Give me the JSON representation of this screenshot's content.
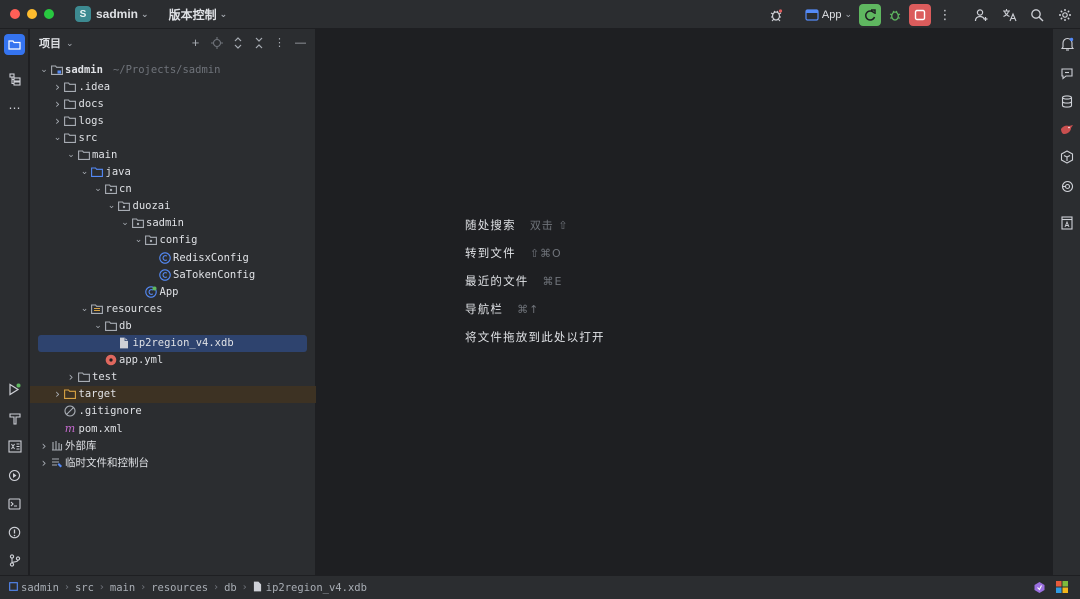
{
  "titlebar": {
    "project_badge": "S",
    "project_name": "sadmin",
    "vcs_label": "版本控制",
    "run_config": "App",
    "colors": {
      "run_button": "#5fb760",
      "stop_button": "#db5c5c",
      "badge": "#3d8a91"
    }
  },
  "project_panel": {
    "title": "项目"
  },
  "tree": [
    {
      "label": "sadmin",
      "path": "~/Projects/sadmin",
      "depth": 0,
      "expanded": true,
      "icon": "module-folder-icon",
      "bold": true
    },
    {
      "label": ".idea",
      "depth": 1,
      "expanded": false,
      "icon": "folder-icon"
    },
    {
      "label": "docs",
      "depth": 1,
      "expanded": false,
      "icon": "folder-icon"
    },
    {
      "label": "logs",
      "depth": 1,
      "expanded": false,
      "icon": "folder-icon"
    },
    {
      "label": "src",
      "depth": 1,
      "expanded": true,
      "icon": "folder-icon"
    },
    {
      "label": "main",
      "depth": 2,
      "expanded": true,
      "icon": "folder-icon"
    },
    {
      "label": "java",
      "depth": 3,
      "expanded": true,
      "icon": "source-folder-icon"
    },
    {
      "label": "cn",
      "depth": 4,
      "expanded": true,
      "icon": "package-icon"
    },
    {
      "label": "duozai",
      "depth": 5,
      "expanded": true,
      "icon": "package-icon"
    },
    {
      "label": "sadmin",
      "depth": 6,
      "expanded": true,
      "icon": "package-icon"
    },
    {
      "label": "config",
      "depth": 7,
      "expanded": true,
      "icon": "package-icon"
    },
    {
      "label": "RedisxConfig",
      "depth": 8,
      "icon": "java-class-icon"
    },
    {
      "label": "SaTokenConfig",
      "depth": 8,
      "icon": "java-class-icon"
    },
    {
      "label": "App",
      "depth": 7,
      "icon": "spring-app-class-icon"
    },
    {
      "label": "resources",
      "depth": 3,
      "expanded": true,
      "icon": "resources-folder-icon"
    },
    {
      "label": "db",
      "depth": 4,
      "expanded": true,
      "icon": "folder-icon"
    },
    {
      "label": "ip2region_v4.xdb",
      "depth": 5,
      "icon": "file-icon",
      "selected": true
    },
    {
      "label": "app.yml",
      "depth": 4,
      "icon": "yaml-file-icon"
    },
    {
      "label": "test",
      "depth": 2,
      "expanded": false,
      "icon": "folder-icon"
    },
    {
      "label": "target",
      "depth": 1,
      "expanded": false,
      "icon": "excluded-folder-icon",
      "excluded": true
    },
    {
      "label": ".gitignore",
      "depth": 1,
      "icon": "gitignore-icon"
    },
    {
      "label": "pom.xml",
      "depth": 1,
      "icon": "maven-icon"
    },
    {
      "label": "外部库",
      "depth": 0,
      "expanded": false,
      "icon": "library-icon"
    },
    {
      "label": "临时文件和控制台",
      "depth": 0,
      "expanded": false,
      "icon": "scratches-icon"
    }
  ],
  "editor_hints": [
    {
      "label": "随处搜索",
      "key": "双击 ⇧"
    },
    {
      "label": "转到文件",
      "key": "⇧⌘O"
    },
    {
      "label": "最近的文件",
      "key": "⌘E"
    },
    {
      "label": "导航栏",
      "key": "⌘↑"
    },
    {
      "label": "将文件拖放到此处以打开",
      "key": ""
    }
  ],
  "breadcrumbs": [
    "sadmin",
    "src",
    "main",
    "resources",
    "db",
    "ip2region_v4.xdb"
  ]
}
